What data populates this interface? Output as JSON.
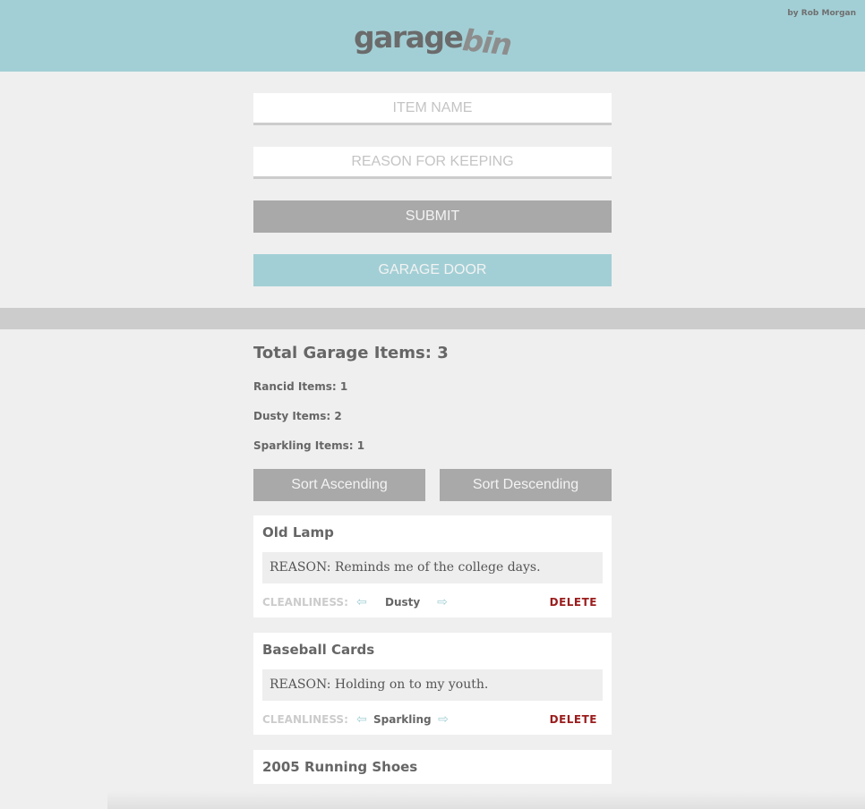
{
  "header": {
    "logo_part1": "garage",
    "logo_part2": "bin",
    "byline": "by Rob Morgan",
    "background_color": "#a2cfd5"
  },
  "form": {
    "item_name_placeholder": "ITEM NAME",
    "reason_placeholder": "REASON FOR KEEPING",
    "submit_label": "SUBMIT",
    "garage_door_label": "GARAGE DOOR"
  },
  "stats": {
    "total_label": "Total Garage Items: 3",
    "rancid_label": "Rancid Items: 1",
    "dusty_label": "Dusty Items: 2",
    "sparkling_label": "Sparkling Items: 1"
  },
  "sort": {
    "ascending_label": "Sort Ascending",
    "descending_label": "Sort Descending"
  },
  "items": [
    {
      "name": "Old Lamp",
      "reason": "REASON: Reminds me of the college days.",
      "cleanliness_label": "CLEANLINESS:",
      "cleanliness": "Dusty",
      "delete_label": "DELETE",
      "left_arrow_icon": "arrow-left-icon",
      "right_arrow_icon": "arrow-right-icon"
    },
    {
      "name": "Baseball Cards",
      "reason": "REASON: Holding on to my youth.",
      "cleanliness_label": "CLEANLINESS:",
      "cleanliness": "Sparkling",
      "delete_label": "DELETE",
      "left_arrow_icon": "arrow-left-icon",
      "right_arrow_icon": "arrow-right-icon"
    },
    {
      "name": "2005 Running Shoes"
    }
  ],
  "colors": {
    "accent": "#a2cfd5",
    "button_gray": "#a9a9a9",
    "delete_red": "#9b1c1c",
    "page_bg": "#efefef"
  }
}
